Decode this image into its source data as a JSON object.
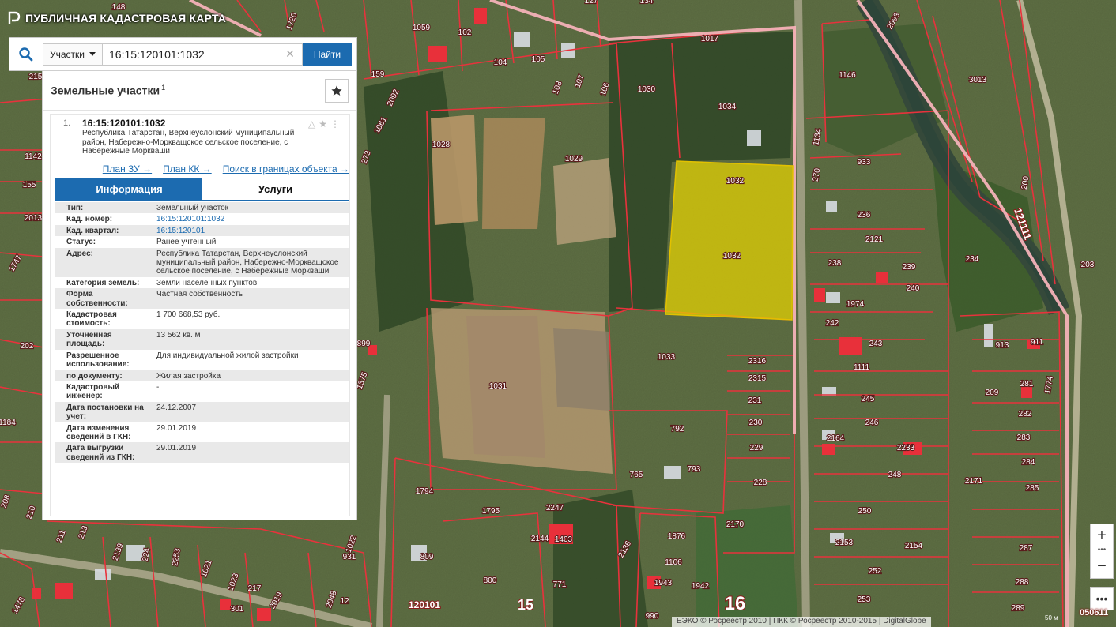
{
  "app": {
    "title": "ПУБЛИЧНАЯ КАДАСТРОВАЯ КАРТА"
  },
  "search": {
    "category": "Участки",
    "query": "16:15:120101:1032",
    "clear_glyph": "✕",
    "button_label": "Найти"
  },
  "panel": {
    "title": "Земельные участки",
    "count": "1",
    "result": {
      "index": "1.",
      "cadnum": "16:15:120101:1032",
      "address": "Республика Татарстан, Верхнеуслонский муниципальный район, Набережно-Моркващское сельское поселение, с Набережные Моркваши",
      "links": [
        "План ЗУ →",
        "План КК →",
        "Поиск в границах объекта →"
      ]
    },
    "tabs": [
      "Информация",
      "Услуги"
    ],
    "attributes": [
      {
        "key": "Тип:",
        "value": "Земельный участок"
      },
      {
        "key": "Кад. номер:",
        "value": "16:15:120101:1032",
        "link": true
      },
      {
        "key": "Кад. квартал:",
        "value": "16:15:120101",
        "link": true
      },
      {
        "key": "Статус:",
        "value": "Ранее учтенный"
      },
      {
        "key": "Адрес:",
        "value": "Республика Татарстан, Верхнеуслонский муниципальный район, Набережно-Моркващское сельское поселение, с Набережные Моркваши"
      },
      {
        "key": "Категория земель:",
        "value": "Земли населённых пунктов"
      },
      {
        "key": "Форма собственности:",
        "value": "Частная собственность"
      },
      {
        "key": "Кадастровая стоимость:",
        "value": "1 700 668,53 руб."
      },
      {
        "key": "Уточненная площадь:",
        "value": "13 562 кв. м"
      },
      {
        "key": "Разрешенное использование:",
        "value": "Для индивидуальной жилой застройки"
      },
      {
        "key": "по документу:",
        "value": "Жилая застройка"
      },
      {
        "key": "Кадастровый инженер:",
        "value": "-"
      },
      {
        "key": "Дата постановки на учет:",
        "value": "24.12.2007"
      },
      {
        "key": "Дата изменения сведений в ГКН:",
        "value": "29.01.2019"
      },
      {
        "key": "Дата выгрузки сведений из ГКН:",
        "value": "29.01.2019"
      }
    ]
  },
  "map": {
    "plot_labels": [
      "148",
      "127",
      "134",
      "1720",
      "1059",
      "102",
      "104",
      "105",
      "1017",
      "1030",
      "1034",
      "1146",
      "3013",
      "2093",
      "159",
      "2092",
      "108",
      "107",
      "106",
      "1028",
      "1029",
      "1032",
      "1032",
      "1134",
      "933",
      "270",
      "236",
      "2121",
      "238",
      "239",
      "240",
      "1974",
      "242",
      "243",
      "1111",
      "245",
      "246",
      "2164",
      "2233",
      "248",
      "2171",
      "250",
      "2153",
      "2154",
      "252",
      "253",
      "234",
      "203",
      "200",
      "209",
      "913",
      "911",
      "281",
      "1774",
      "282",
      "283",
      "284",
      "285",
      "287",
      "288",
      "289",
      "1033",
      "2316",
      "2315",
      "231",
      "230",
      "229",
      "228",
      "792",
      "793",
      "765",
      "1031",
      "1794",
      "1795",
      "2247",
      "2144",
      "1403",
      "809",
      "800",
      "771",
      "1876",
      "1106",
      "1943",
      "1942",
      "990",
      "2170",
      "2136",
      "215",
      "1142",
      "155",
      "2013",
      "1747",
      "202",
      "1184",
      "208",
      "210",
      "211",
      "213",
      "2139",
      "224",
      "2253",
      "931",
      "1022",
      "1021",
      "1023",
      "217",
      "2019",
      "1478",
      "899",
      "1375",
      "2048",
      "273",
      "1061",
      "12",
      "301"
    ],
    "quarter_labels": [
      "120101",
      "15",
      "16",
      "121111"
    ],
    "selected_plot": "1032"
  },
  "controls": {
    "zoom_in": "+",
    "zoom_out": "−",
    "zoom_dots": "•••",
    "more": "•••"
  },
  "footer": {
    "attribution": "ЕЭКО © Росреестр 2010 | ПКК © Росреестр 2010-2015 | DigitalGlobe",
    "scale": "50 м",
    "corner_quarter": "050611"
  },
  "colors": {
    "accent": "#1c6bb0",
    "boundary": "#e8323c",
    "selected_fill": "#e6d200",
    "road": "#f2b3b8"
  }
}
